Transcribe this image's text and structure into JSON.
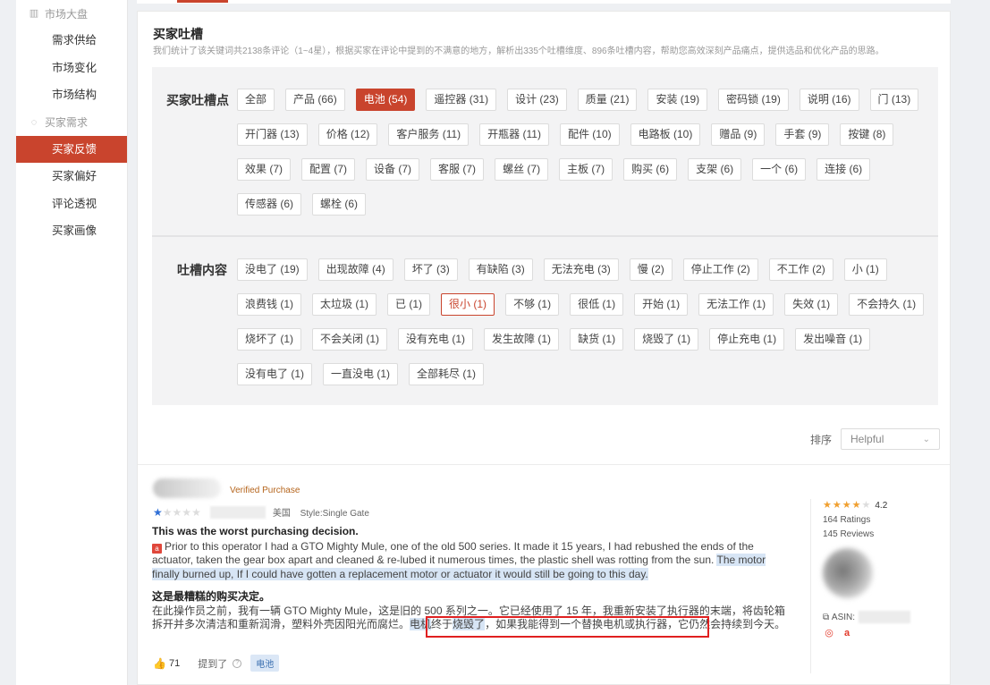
{
  "sidebar": {
    "groups": [
      {
        "label": "市场大盘",
        "items": [
          "需求供给",
          "市场变化",
          "市场结构"
        ]
      },
      {
        "label": "买家需求",
        "items": [
          "买家反馈",
          "买家偏好",
          "评论透视",
          "买家画像"
        ]
      }
    ],
    "active_item": "买家反馈"
  },
  "section": {
    "title": "买家吐槽",
    "description": "我们统计了该关键词共2138条评论（1~4星），根据买家在评论中提到的不满意的地方，解析出335个吐槽维度、896条吐槽内容，帮助您高效深刻产品痛点，提供选品和优化产品的思路。"
  },
  "complaint_points": {
    "label": "买家吐槽点",
    "selected": "电池 (54)",
    "tags": [
      "全部",
      "产品 (66)",
      "电池 (54)",
      "遥控器 (31)",
      "设计 (23)",
      "质量 (21)",
      "安装 (19)",
      "密码锁 (19)",
      "说明 (16)",
      "门 (13)",
      "开门器 (13)",
      "价格 (12)",
      "客户服务 (11)",
      "开瓶器 (11)",
      "配件 (10)",
      "电路板 (10)",
      "赠品 (9)",
      "手套 (9)",
      "按键 (8)",
      "效果 (7)",
      "配置 (7)",
      "设备 (7)",
      "客服 (7)",
      "螺丝 (7)",
      "主板 (7)",
      "购买 (6)",
      "支架 (6)",
      "一个 (6)",
      "连接 (6)",
      "传感器 (6)",
      "螺栓 (6)"
    ]
  },
  "complaint_content": {
    "label": "吐槽内容",
    "outlined": "很小 (1)",
    "tags": [
      "没电了 (19)",
      "出现故障 (4)",
      "坏了 (3)",
      "有缺陷 (3)",
      "无法充电 (3)",
      "慢 (2)",
      "停止工作 (2)",
      "不工作 (2)",
      "小 (1)",
      "浪费钱 (1)",
      "太垃圾 (1)",
      "已 (1)",
      "很小 (1)",
      "不够 (1)",
      "很低 (1)",
      "开始 (1)",
      "无法工作 (1)",
      "失效 (1)",
      "不会持久 (1)",
      "烧坏了 (1)",
      "不会关闭 (1)",
      "没有充电 (1)",
      "发生故障 (1)",
      "缺货 (1)",
      "烧毁了 (1)",
      "停止充电 (1)",
      "发出噪音 (1)",
      "没有电了 (1)",
      "一直没电 (1)",
      "全部耗尽 (1)"
    ]
  },
  "sort": {
    "label": "排序",
    "value": "Helpful"
  },
  "review": {
    "verified": "Verified Purchase",
    "rating": 1,
    "country": "美国",
    "style": "Style:Single Gate",
    "title_en": "This was the worst purchasing decision.",
    "amazon_badge": "a",
    "body_en_plain": "Prior to this operator I had a GTO Mighty Mule, one of the old 500 series. It made it 15 years, I had rebushed the ends of the actuator, taken the gear box apart and cleaned & re-lubed it numerous times, the plastic shell was rotting from the sun.",
    "body_en_highlight": "The motor finally burned up, If I could have gotten a replacement motor or actuator it would still be going to this day.",
    "title_zh": "这是最糟糕的购买决定。",
    "body_zh_plain": "在此操作员之前，我有一辆 GTO Mighty Mule，这是旧的 500 系列之一。它已经使用了 15 年，我重新安装了执行器的末端，将齿轮箱拆开并多次清洁和重新润滑，塑料外壳因阳光而腐烂。",
    "body_zh_hl1": "电机",
    "body_zh_mid": "终于",
    "body_zh_hl2": "烧毁了",
    "body_zh_sep": "，",
    "body_zh_boxed": "如果我能得到一个替换电机或执行器，它仍然会持续到今天。",
    "likes": "71",
    "mentioned_label": "提到了",
    "mentioned_tag": "电池"
  },
  "product": {
    "stars": 4,
    "rating": "4.2",
    "ratings": "164 Ratings",
    "reviews": "145 Reviews",
    "asin_label": "ASIN:"
  }
}
